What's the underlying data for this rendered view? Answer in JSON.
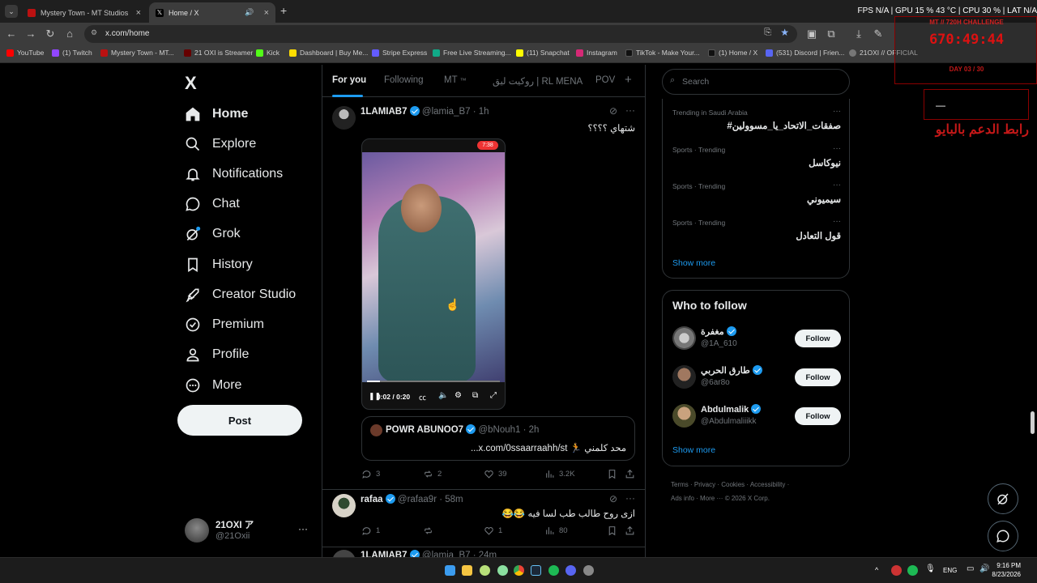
{
  "browser": {
    "tabs": [
      {
        "title": "Mystery Town - MT Studios | M",
        "active": false
      },
      {
        "title": "Home / X",
        "active": true
      }
    ],
    "url": "x.com/home",
    "bookmarks": [
      "YouTube",
      "(1) Twitch",
      "Mystery Town - MT...",
      "21 OXI is Streamer",
      "Kick",
      "Dashboard | Buy Me...",
      "Stripe Express",
      "Free Live Streaming...",
      "(11) Snapchat",
      "Instagram",
      "TikTok - Make Your...",
      "(1) Home / X",
      "(531) Discord | Frien...",
      "21OXI // OFFICIAL"
    ],
    "stats": "FPS  N/A  |  GPU  15 %  43 °C  |  CPU  30 %  |  LAT  N/A"
  },
  "overlay": {
    "title": "MT // 720H CHALLENGE",
    "timer": "670:49:44",
    "day": "DAY 03 / 30",
    "box_line": "—",
    "arabic": "رابط الدعم بالبايو"
  },
  "sidebar": {
    "logo": "X",
    "items": [
      {
        "label": "Home",
        "icon": "home-icon"
      },
      {
        "label": "Explore",
        "icon": "search-icon"
      },
      {
        "label": "Notifications",
        "icon": "bell-icon"
      },
      {
        "label": "Chat",
        "icon": "chat-icon"
      },
      {
        "label": "Grok",
        "icon": "grok-icon"
      },
      {
        "label": "History",
        "icon": "bookmark-icon"
      },
      {
        "label": "Creator Studio",
        "icon": "rocket-icon"
      },
      {
        "label": "Premium",
        "icon": "verified-icon"
      },
      {
        "label": "Profile",
        "icon": "person-icon"
      },
      {
        "label": "More",
        "icon": "more-circle-icon"
      }
    ],
    "post_label": "Post",
    "account": {
      "name": "21OXI ア",
      "handle": "@21Oxii"
    }
  },
  "feed": {
    "tabs": [
      "For you",
      "Following",
      "MT",
      "روكيت ليق | RL MENA",
      "POV"
    ],
    "tweet1": {
      "name": "1LAMIAB7",
      "handle": "@lamia_B7 · 1h",
      "text": "شتهاي ؟؟؟؟",
      "video_time": "0:02 / 0:20",
      "phone_time": "7:38",
      "quote": {
        "name": "POWR ABUNOO7",
        "handle": "@bNouh1 · 2h",
        "text": "محد كلمني 🏃 x.com/0ssaarraahh/st..."
      },
      "replies": "3",
      "reposts": "2",
      "likes": "39",
      "views": "3.2K"
    },
    "tweet2": {
      "name": "rafaa",
      "handle": "@rafaa9r · 58m",
      "text": "ازى روح طالب طب لسا فيه 😂😂",
      "replies": "1",
      "reposts": "",
      "likes": "1",
      "views": "80"
    },
    "tweet3": {
      "name": "1LAMIAB7",
      "handle": "@lamia_B7 · 24m"
    }
  },
  "right": {
    "search_placeholder": "Search",
    "trends": [
      {
        "category": "Trending in Saudi Arabia",
        "name": "#صفقات_الاتحاد_يا_مسوولين"
      },
      {
        "category": "Sports · Trending",
        "name": "نيوكاسل"
      },
      {
        "category": "Sports · Trending",
        "name": "سيميوني"
      },
      {
        "category": "Sports · Trending",
        "name": "قول التعادل"
      }
    ],
    "show_more": "Show more",
    "who_to_follow_title": "Who to follow",
    "follow_label": "Follow",
    "suggestions": [
      {
        "name": "مغفرة",
        "handle": "@1A_610"
      },
      {
        "name": "طارق الحربي",
        "handle": "@6ar8o"
      },
      {
        "name": "Abdulmalik",
        "handle": "@Abdulmaliiikk"
      }
    ],
    "footer": {
      "links": [
        "Terms",
        "Privacy",
        "Cookies",
        "Accessibility",
        "Ads info",
        "More ···"
      ],
      "copyright": "© 2026 X Corp."
    }
  },
  "taskbar": {
    "lang": "ENG",
    "time": "9:16 PM",
    "date": "8/23/2026"
  },
  "colors": {
    "accent": "#1d9bf0",
    "background": "#000000",
    "border": "#2f3336",
    "overlay_red": "#d11111"
  }
}
